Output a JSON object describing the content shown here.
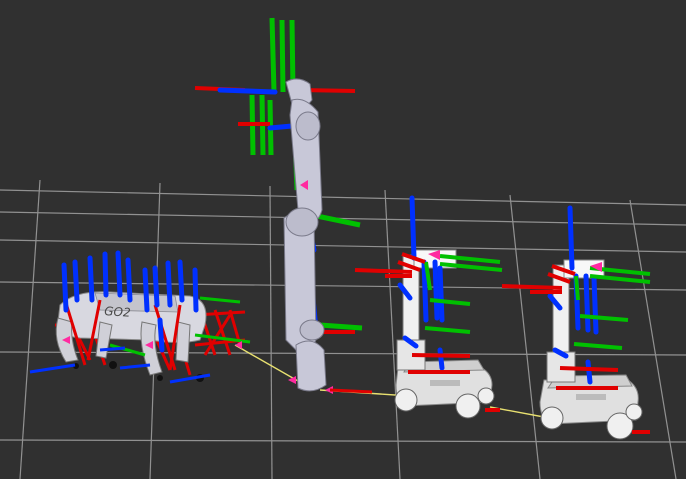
{
  "viewport": {
    "background": "#303030",
    "grid_color": "#a0a0a0",
    "axis_colors": {
      "x": "#e00000",
      "y": "#00c000",
      "z": "#0030ff"
    },
    "tf_link_color": "#e8e070"
  },
  "robots": {
    "quadruped": {
      "label": "GO2",
      "body_color": "#d8d8e0"
    },
    "arm": {
      "body_color": "#c8c8d8"
    },
    "mobile_base_1": {
      "base_label": "",
      "body_color": "#e0e0e0"
    },
    "mobile_base_2": {
      "base_label": "",
      "body_color": "#e0e0e0"
    }
  }
}
